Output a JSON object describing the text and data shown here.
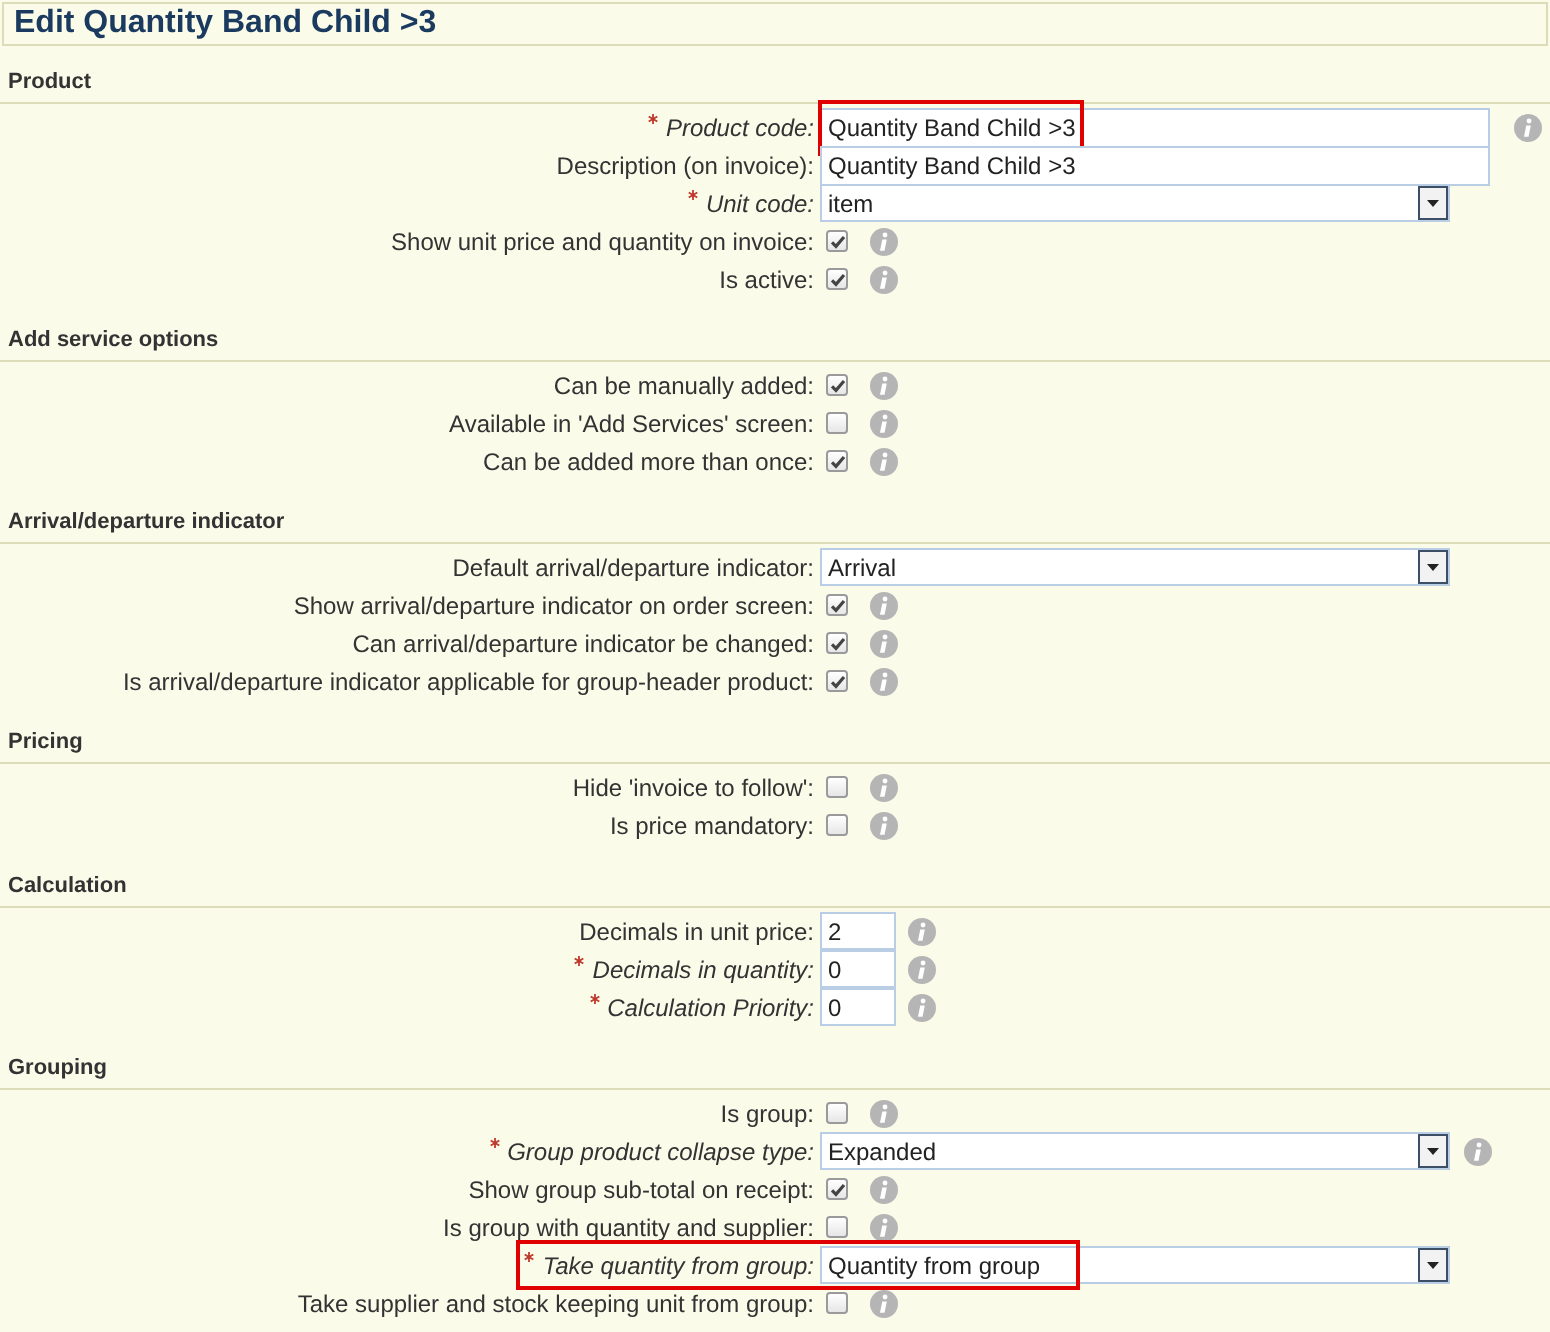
{
  "title": "Edit Quantity Band Child >3",
  "sections": [
    {
      "heading": "Product",
      "rows": [
        {
          "kind": "text",
          "label": "Product code:",
          "required": true,
          "value": "Quantity Band Child >3",
          "info": true,
          "highlighted": true
        },
        {
          "kind": "text",
          "label": "Description (on invoice):",
          "required": false,
          "value": "Quantity Band Child >3",
          "info": false
        },
        {
          "kind": "select",
          "label": "Unit code:",
          "required": true,
          "value": "item",
          "info": false
        },
        {
          "kind": "checkbox",
          "label": "Show unit price and quantity on invoice:",
          "required": false,
          "checked": true,
          "info": true
        },
        {
          "kind": "checkbox",
          "label": "Is active:",
          "required": false,
          "checked": true,
          "info": true
        }
      ]
    },
    {
      "heading": "Add service options",
      "rows": [
        {
          "kind": "checkbox",
          "label": "Can be manually added:",
          "required": false,
          "checked": true,
          "info": true
        },
        {
          "kind": "checkbox",
          "label": "Available in 'Add Services' screen:",
          "required": false,
          "checked": false,
          "info": true
        },
        {
          "kind": "checkbox",
          "label": "Can be added more than once:",
          "required": false,
          "checked": true,
          "info": true
        }
      ]
    },
    {
      "heading": "Arrival/departure indicator",
      "rows": [
        {
          "kind": "select",
          "label": "Default arrival/departure indicator:",
          "required": false,
          "value": "Arrival",
          "info": false
        },
        {
          "kind": "checkbox",
          "label": "Show arrival/departure indicator on order screen:",
          "required": false,
          "checked": true,
          "info": true
        },
        {
          "kind": "checkbox",
          "label": "Can arrival/departure indicator be changed:",
          "required": false,
          "checked": true,
          "info": true
        },
        {
          "kind": "checkbox",
          "label": "Is arrival/departure indicator applicable for group-header product:",
          "required": false,
          "checked": true,
          "info": true
        }
      ]
    },
    {
      "heading": "Pricing",
      "rows": [
        {
          "kind": "checkbox",
          "label": "Hide 'invoice to follow':",
          "required": false,
          "checked": false,
          "info": true
        },
        {
          "kind": "checkbox",
          "label": "Is price mandatory:",
          "required": false,
          "checked": false,
          "info": true
        }
      ]
    },
    {
      "heading": "Calculation",
      "rows": [
        {
          "kind": "number",
          "label": "Decimals in unit price:",
          "required": false,
          "value": "2",
          "info": true
        },
        {
          "kind": "number",
          "label": "Decimals in quantity:",
          "required": true,
          "value": "0",
          "info": true
        },
        {
          "kind": "number",
          "label": "Calculation Priority:",
          "required": true,
          "value": "0",
          "info": true
        }
      ]
    },
    {
      "heading": "Grouping",
      "rows": [
        {
          "kind": "checkbox",
          "label": "Is group:",
          "required": false,
          "checked": false,
          "info": true
        },
        {
          "kind": "select",
          "label": "Group product collapse type:",
          "required": true,
          "value": "Expanded",
          "info": true
        },
        {
          "kind": "checkbox",
          "label": "Show group sub-total on receipt:",
          "required": false,
          "checked": true,
          "info": true
        },
        {
          "kind": "checkbox",
          "label": "Is group with quantity and supplier:",
          "required": false,
          "checked": false,
          "info": true
        },
        {
          "kind": "select",
          "label": "Take quantity from group:",
          "required": true,
          "value": "Quantity from group",
          "info": false,
          "highlighted": true
        },
        {
          "kind": "checkbox",
          "label": "Take supplier and stock keeping unit from group:",
          "required": false,
          "checked": false,
          "info": true
        }
      ]
    }
  ]
}
